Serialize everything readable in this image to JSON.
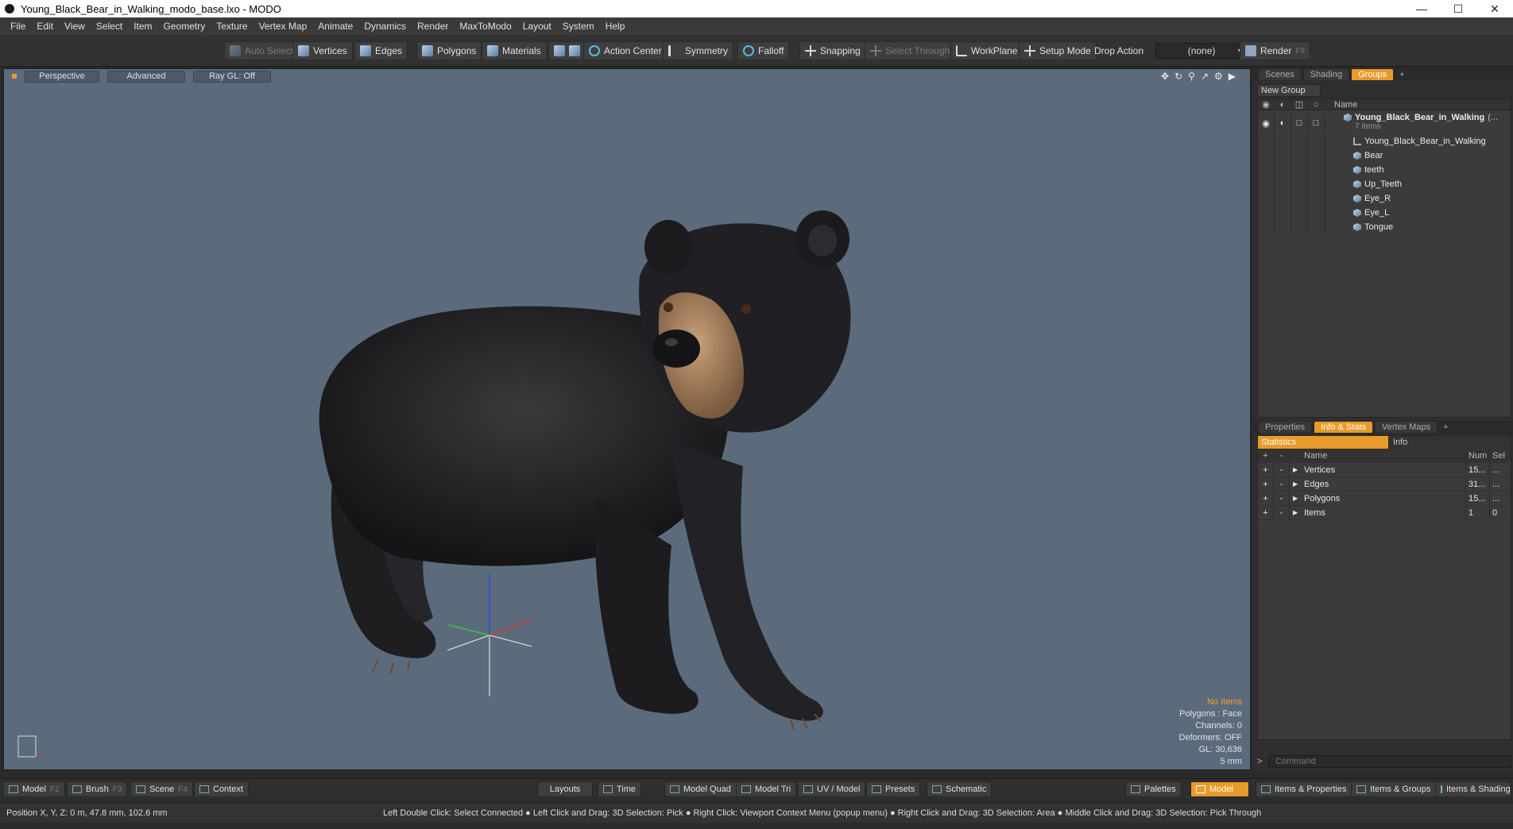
{
  "window": {
    "title": "Young_Black_Bear_in_Walking_modo_base.lxo - MODO"
  },
  "menu": [
    "File",
    "Edit",
    "View",
    "Select",
    "Item",
    "Geometry",
    "Texture",
    "Vertex Map",
    "Animate",
    "Dynamics",
    "Render",
    "MaxToModo",
    "Layout",
    "System",
    "Help"
  ],
  "toolbar": {
    "auto_select": "Auto Select",
    "vertices": "Vertices",
    "edges": "Edges",
    "polygons": "Polygons",
    "materials": "Materials",
    "action_center": "Action Center",
    "symmetry": "Symmetry",
    "falloff": "Falloff",
    "snapping": "Snapping",
    "select_through": "Select Through",
    "workplane": "WorkPlane",
    "setup_mode": "Setup Mode",
    "drop_action": "Drop Action",
    "drop_action_value": "(none)",
    "render": "Render",
    "render_key": "F9"
  },
  "viewport": {
    "view_mode": "Perspective",
    "shading": "Advanced",
    "raygl": "Ray GL: Off",
    "stats": {
      "items": "No Items",
      "polygons": "Polygons : Face",
      "channels": "Channels: 0",
      "deformers": "Deformers: OFF",
      "gl": "GL: 30,636",
      "scale": "5 mm"
    }
  },
  "top_tabs": {
    "scenes": "Scenes",
    "shading": "Shading",
    "groups": "Groups",
    "plus": "+"
  },
  "groups": {
    "new_group": "New Group",
    "column_name": "Name",
    "root": {
      "name": "Young_Black_Bear_in_Walking",
      "suffix": "(...",
      "count": "7 Items"
    },
    "items": [
      {
        "name": "Young_Black_Bear_in_Walking",
        "icon": "locator-icon"
      },
      {
        "name": "Bear",
        "icon": "mesh-icon"
      },
      {
        "name": "teeth",
        "icon": "mesh-icon"
      },
      {
        "name": "Up_Teeth",
        "icon": "mesh-icon"
      },
      {
        "name": "Eye_R",
        "icon": "mesh-icon"
      },
      {
        "name": "Eye_L",
        "icon": "mesh-icon"
      },
      {
        "name": "Tongue",
        "icon": "mesh-icon"
      }
    ]
  },
  "bottom_tabs": {
    "properties": "Properties",
    "info_stats": "Info & Stats",
    "vertex_maps": "Vertex Maps",
    "plus": "+"
  },
  "statistics": {
    "tab_statistics": "Statistics",
    "tab_info": "Info",
    "col_name": "Name",
    "col_num": "Num",
    "col_sel": "Sel",
    "rows": [
      {
        "name": "Vertices",
        "num": "15...",
        "sel": "..."
      },
      {
        "name": "Edges",
        "num": "31...",
        "sel": "..."
      },
      {
        "name": "Polygons",
        "num": "15...",
        "sel": "..."
      },
      {
        "name": "Items",
        "num": "1",
        "sel": "0"
      }
    ]
  },
  "command": {
    "placeholder": "Command"
  },
  "bottom_bar": {
    "model": "Model",
    "model_key": "F2",
    "brush": "Brush",
    "brush_key": "F3",
    "scene": "Scene",
    "scene_key": "F4",
    "context": "Context",
    "layouts": "Layouts",
    "time": "Time",
    "model_quad": "Model Quad",
    "model_tri": "Model Tri",
    "uv_model": "UV / Model",
    "presets": "Presets",
    "schematic": "Schematic",
    "palettes": "Palettes",
    "model_active": "Model",
    "items_properties": "Items & Properties",
    "items_groups": "Items & Groups",
    "items_shading": "Items & Shading"
  },
  "status": {
    "position": "Position X, Y, Z:   0 m, 47.8 mm, 102.6 mm",
    "hint": "Left Double Click: Select Connected ● Left Click and Drag: 3D Selection: Pick ● Right Click: Viewport Context Menu (popup menu) ● Right Click and Drag: 3D Selection: Area ● Middle Click and Drag: 3D Selection: Pick Through"
  }
}
